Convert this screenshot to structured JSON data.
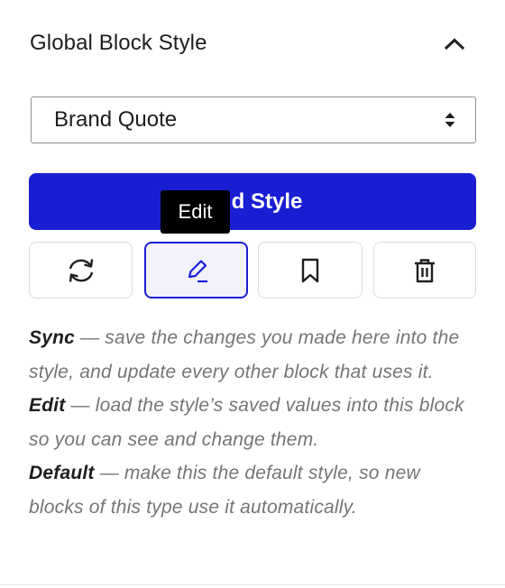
{
  "panel": {
    "title": "Global Block Style",
    "collapse_icon": "chevron-up-icon"
  },
  "style_select": {
    "value": "Brand Quote",
    "icon": "select-arrows-icon"
  },
  "add_button": {
    "label": "Add Style"
  },
  "tooltip": {
    "text": "Edit"
  },
  "actions": [
    {
      "name": "sync",
      "icon": "sync-icon"
    },
    {
      "name": "edit",
      "icon": "pencil-icon",
      "active": true
    },
    {
      "name": "default",
      "icon": "bookmark-icon"
    },
    {
      "name": "delete",
      "icon": "trash-icon"
    }
  ],
  "help": [
    {
      "term": "Sync",
      "desc": " — save the changes you made here into the style, and update every other block that uses it."
    },
    {
      "term": "Edit",
      "desc": " — load the style’s saved values into this block so you can see and change them."
    },
    {
      "term": "Default",
      "desc": " — make this the default style, so new blocks of this type use it automatically."
    }
  ],
  "colors": {
    "accent": "#1a1ed3",
    "text": "#1e1e1e",
    "muted": "#757575",
    "border": "#dcdcde"
  }
}
